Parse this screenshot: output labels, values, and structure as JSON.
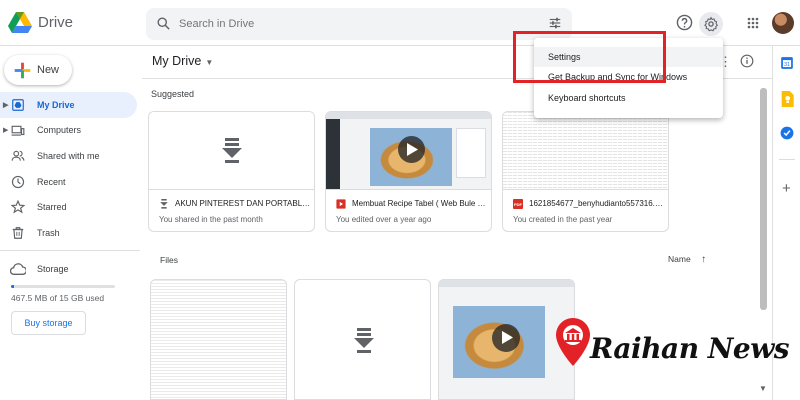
{
  "app": {
    "name": "Drive"
  },
  "search": {
    "placeholder": "Search in Drive"
  },
  "new_button": {
    "label": "New"
  },
  "sidebar": {
    "items": [
      {
        "label": "My Drive",
        "icon": "my-drive-icon",
        "active": true
      },
      {
        "label": "Computers",
        "icon": "computers-icon"
      },
      {
        "label": "Shared with me",
        "icon": "shared-icon"
      },
      {
        "label": "Recent",
        "icon": "clock-icon"
      },
      {
        "label": "Starred",
        "icon": "star-icon"
      },
      {
        "label": "Trash",
        "icon": "trash-icon"
      }
    ],
    "storage": {
      "label": "Storage",
      "used_text": "467.5 MB of 15 GB used",
      "used_fraction": 0.03,
      "buy_label": "Buy storage"
    }
  },
  "main": {
    "title": "My Drive",
    "suggested_label": "Suggested",
    "files_label": "Files",
    "sort_label": "Name",
    "suggested": [
      {
        "title": "AKUN PINTEREST DAN PORTABLEN...",
        "subtitle": "You shared in the past month",
        "type_icon": "file-download-icon"
      },
      {
        "title": "Membuat Recipe Tabel ( Web Bule )....",
        "subtitle": "You edited over a year ago",
        "type_icon": "video-file-icon"
      },
      {
        "title": "1621854677_benyhudianto557316.p...",
        "subtitle": "You created in the past year",
        "type_icon": "pdf-icon",
        "type_text": "PDF"
      }
    ]
  },
  "settings_menu": {
    "items": [
      "Settings",
      "Get Backup and Sync for Windows",
      "Keyboard shortcuts"
    ]
  },
  "watermark": {
    "text": "Raihan News"
  },
  "colors": {
    "accent": "#1a73e8",
    "highlight": "#e32228",
    "active_bg": "#e8f0fe"
  }
}
